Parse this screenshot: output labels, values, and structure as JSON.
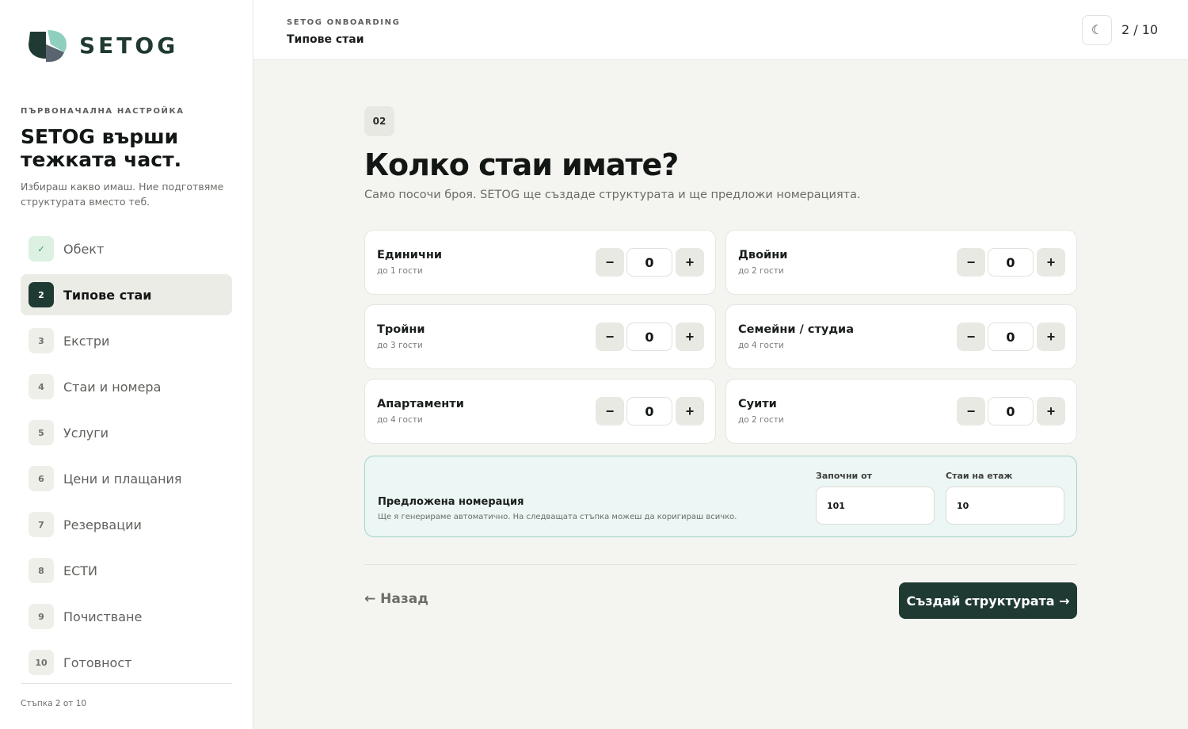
{
  "brand": {
    "name": "SETOG"
  },
  "sidebar": {
    "eyebrow": "ПЪРВОНАЧАЛНА НАСТРОЙКА",
    "headline": "SETOG върши тежката част.",
    "subtext": "Избираш какво имаш. Ние подготвяме структурата вместо теб.",
    "steps": [
      {
        "num": "✓",
        "label": "Обект",
        "state": "done"
      },
      {
        "num": "2",
        "label": "Типове стаи",
        "state": "active"
      },
      {
        "num": "3",
        "label": "Екстри",
        "state": "todo"
      },
      {
        "num": "4",
        "label": "Стаи и номера",
        "state": "todo"
      },
      {
        "num": "5",
        "label": "Услуги",
        "state": "todo"
      },
      {
        "num": "6",
        "label": "Цени и плащания",
        "state": "todo"
      },
      {
        "num": "7",
        "label": "Резервации",
        "state": "todo"
      },
      {
        "num": "8",
        "label": "ЕСТИ",
        "state": "todo"
      },
      {
        "num": "9",
        "label": "Почистване",
        "state": "todo"
      },
      {
        "num": "10",
        "label": "Готовност",
        "state": "todo"
      }
    ],
    "footer": "Стъпка 2 от 10"
  },
  "topbar": {
    "eyebrow": "SETOG ONBOARDING",
    "title": "Типове стаи",
    "theme_icon": "☾",
    "progress": "2 / 10"
  },
  "main": {
    "badge": "02",
    "title": "Колко стаи имате?",
    "subtitle": "Само посочи броя. SETOG ще създаде структурата и ще предложи номерацията.",
    "rooms": [
      {
        "name": "Единични",
        "capacity": "до 1 гости",
        "value": "0"
      },
      {
        "name": "Двойни",
        "capacity": "до 2 гости",
        "value": "0"
      },
      {
        "name": "Тройни",
        "capacity": "до 3 гости",
        "value": "0"
      },
      {
        "name": "Семейни / студиа",
        "capacity": "до 4 гости",
        "value": "0"
      },
      {
        "name": "Апартаменти",
        "capacity": "до 4 гости",
        "value": "0"
      },
      {
        "name": "Суити",
        "capacity": "до 2 гости",
        "value": "0"
      }
    ],
    "stepper": {
      "minus": "−",
      "plus": "+"
    },
    "numbering": {
      "title": "Предложена номерация",
      "subtitle": "Ще я генерираме автоматично. На следващата стъпка можеш да коригираш всичко.",
      "start_label": "Започни от",
      "start_value": "101",
      "per_floor_label": "Стаи на етаж",
      "per_floor_value": "10"
    },
    "back_label": "← Назад",
    "primary_label": "Създай структурата →"
  },
  "colors": {
    "accent": "#1f3a33",
    "logo_leaf_dark": "#1f3a33",
    "logo_leaf_light": "#8fcfbf",
    "logo_leaf_slate": "#5a6470",
    "done_green": "#2f9c5a",
    "numbering_bg": "#ecf6f4"
  }
}
